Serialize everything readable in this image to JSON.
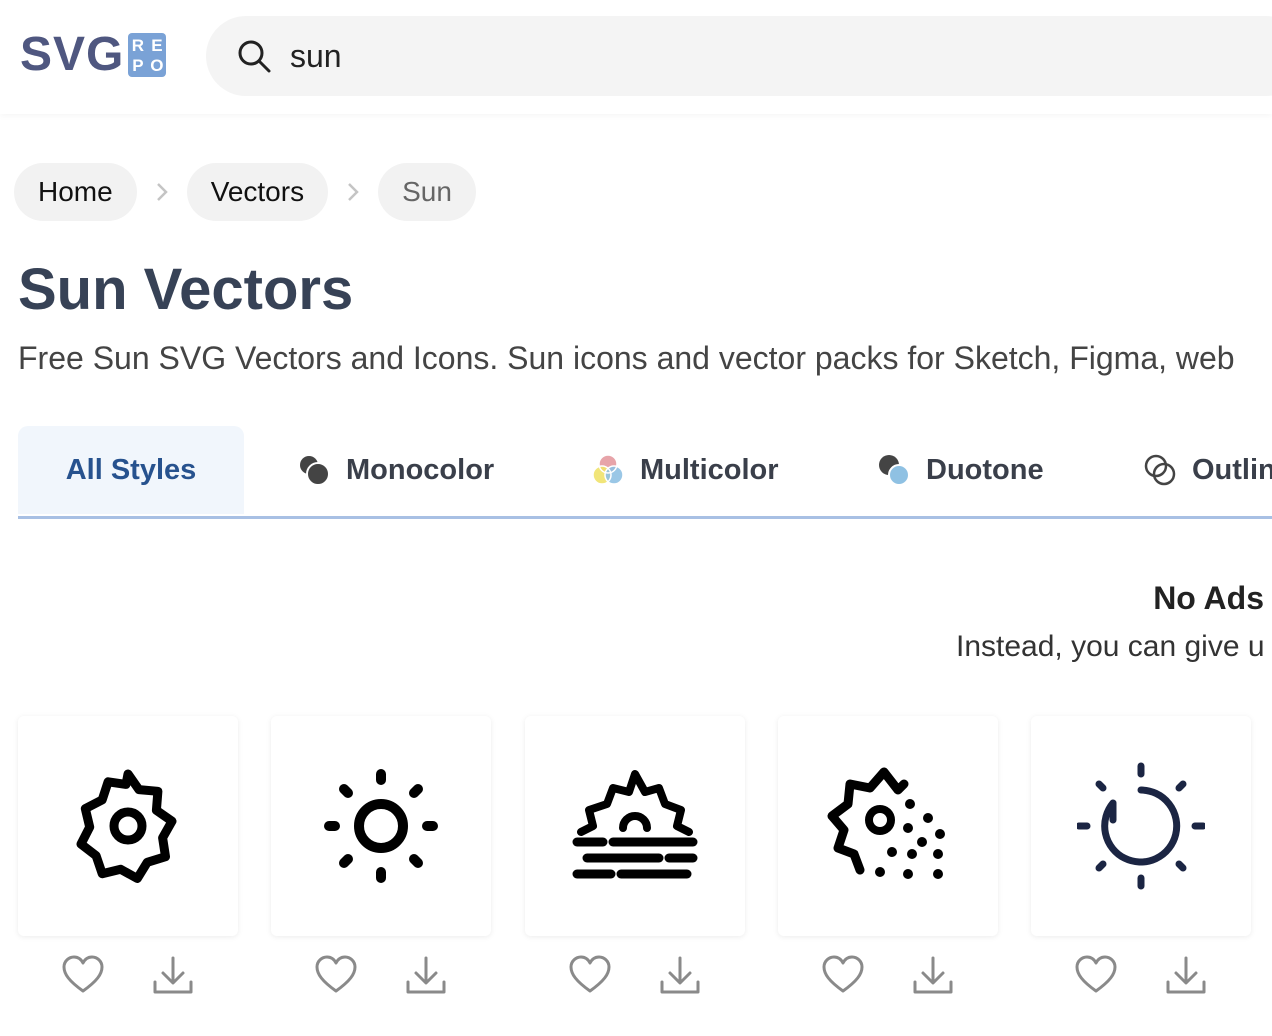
{
  "logo": {
    "text": "SVG",
    "badge_letters": [
      "R",
      "E",
      "P",
      "O"
    ]
  },
  "search": {
    "value": "sun",
    "icon": "search-icon"
  },
  "breadcrumb": [
    {
      "label": "Home"
    },
    {
      "label": "Vectors"
    },
    {
      "label": "Sun"
    }
  ],
  "page": {
    "title": "Sun Vectors",
    "description": "Free Sun SVG Vectors and Icons. Sun icons and vector packs for Sketch, Figma, web"
  },
  "tabs": [
    {
      "label": "All Styles",
      "active": true
    },
    {
      "label": "Monocolor",
      "icon": "monocolor-icon"
    },
    {
      "label": "Multicolor",
      "icon": "multicolor-icon"
    },
    {
      "label": "Duotone",
      "icon": "duotone-icon"
    },
    {
      "label": "Outlin",
      "icon": "outline-icon"
    }
  ],
  "notice": {
    "title": "No Ads",
    "text": "Instead, you can give u"
  },
  "cards": [
    {
      "icon": "sun-gear-icon"
    },
    {
      "icon": "sun-rays-icon"
    },
    {
      "icon": "sunrise-fog-icon"
    },
    {
      "icon": "sun-dust-icon"
    },
    {
      "icon": "sun-outline-icon"
    }
  ],
  "colors": {
    "accent": "#27528e",
    "tab_underline": "#a8c0e4",
    "logo_text": "#4f5780",
    "logo_badge": "#7aa2d6",
    "title": "#374256",
    "icon_dark_blue": "#1b2543"
  }
}
